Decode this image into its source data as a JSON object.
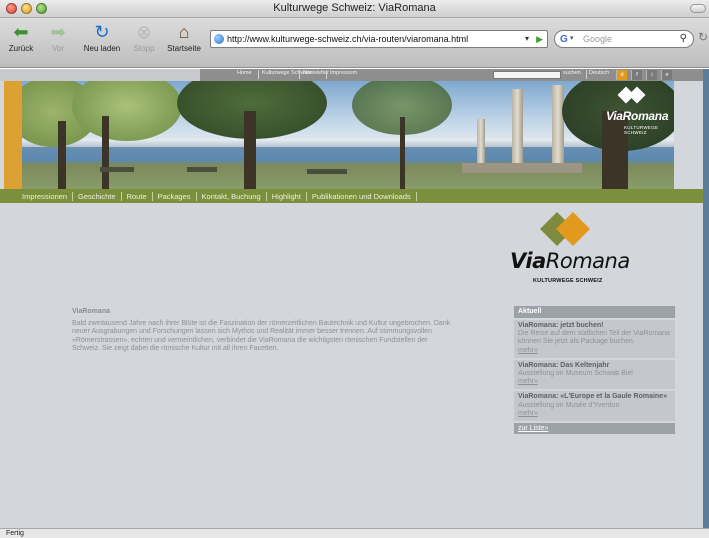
{
  "window": {
    "title": "Kulturwege Schweiz: ViaRomana"
  },
  "toolbar": {
    "back_label": "Zurück",
    "forward_label": "Vor",
    "reload_label": "Neu laden",
    "stop_label": "Stopp",
    "home_label": "Startseite",
    "url": "http://www.kulturwege-schweiz.ch/via-routen/viaromana.html",
    "search_placeholder": "Google"
  },
  "topnav": {
    "items": [
      "Home",
      "Kulturwege Schweiz",
      "Newsletter",
      "Impressum"
    ],
    "search_button": "suchen",
    "language_label": "Deutsch",
    "languages": [
      "d",
      "f",
      "i",
      "e"
    ],
    "active_language": "d"
  },
  "banner": {
    "logo_word": "ViaRomana",
    "logo_sub": "KULTURWEGE SCHWEIZ"
  },
  "mainnav": {
    "items": [
      "Impressionen",
      "Geschichte",
      "Route",
      "Packages",
      "Kontakt, Buchung",
      "Highlight",
      "Publikationen und Downloads"
    ]
  },
  "logo": {
    "via": "Via",
    "romana": "Romana",
    "subtitle": "KULTURWEGE SCHWEIZ"
  },
  "content": {
    "title": "ViaRomana",
    "body": "Bald zweitausend Jahre nach ihrer Blüte ist die Faszination der römerzeitlichen Bautechnik und Kultur ungebrochen. Dank neuer Ausgrabungen und Forschungen lassen sich Mythos und Realität immer besser trennen. Auf stimmungsvollen «Römerstrassen», echten und vermeintlichen, verbindet die ViaRomana die wichtigsten römischen Fundstellen der Schweiz. Sie zeigt dabei die römische Kultur mit all ihren Facetten."
  },
  "aktuell": {
    "heading": "Aktuell",
    "news": [
      {
        "title": "ViaRomana: jetzt buchen!",
        "body": "Die Reise auf dem südlichen Teil der ViaRomana können Sie jetzt als Package buchen.",
        "more": "mehr»"
      },
      {
        "title": "ViaRomana: Das Keltenjahr",
        "body": "Ausstellung im Museum Schwab Biel",
        "more": "mehr»"
      },
      {
        "title": "ViaRomana: «L'Europe et la Gaule Romaine»",
        "body": "Ausstellung im Musée d'Yverdon",
        "more": "mehr»"
      }
    ],
    "list_link": "zur Liste»"
  },
  "status": {
    "text": "Fertig"
  },
  "colors": {
    "accent_orange": "#e29a1e",
    "nav_green": "#7b8f3d",
    "page_bg": "#d3d6da"
  }
}
